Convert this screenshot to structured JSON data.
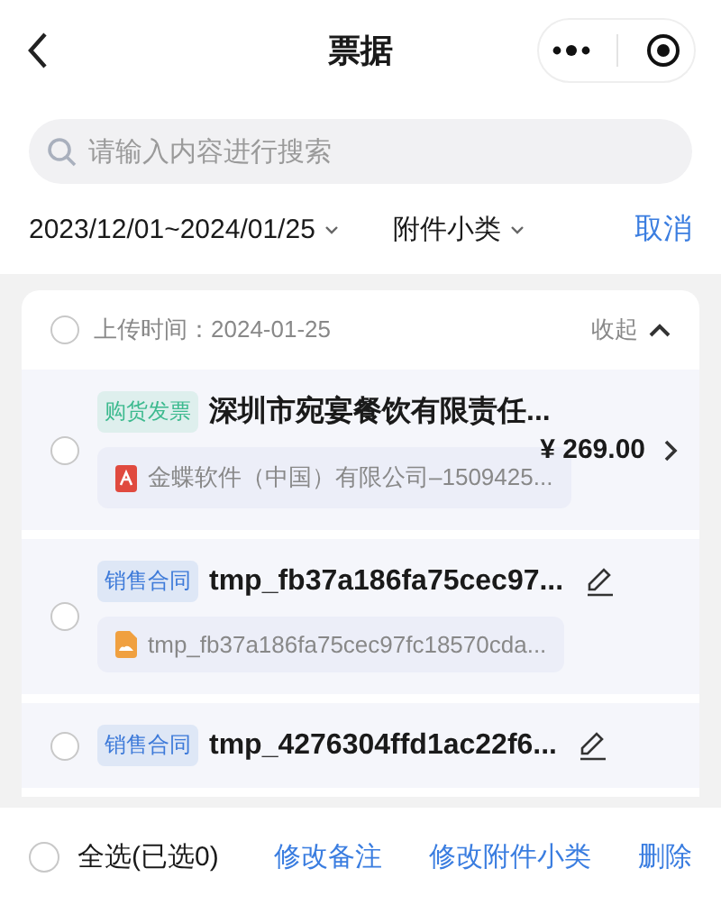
{
  "header": {
    "title": "票据"
  },
  "search": {
    "placeholder": "请输入内容进行搜索"
  },
  "filters": {
    "date_range": "2023/12/01~2024/01/25",
    "subtype": "附件小类",
    "cancel": "取消"
  },
  "group": {
    "checked": false,
    "upload_label": "上传时间：2024-01-25",
    "collapse": "收起",
    "expanded": true,
    "items": [
      {
        "tag": "购货发票",
        "color": "#3dba8f",
        "title": "深圳市宛宴餐饮有限责任...",
        "price": "¥ 269.00",
        "file": {
          "kind": "pdf",
          "name": "金蝶软件（中国）有限公司–1509425..."
        },
        "checked": false,
        "editable": false
      },
      {
        "tag": "销售合同",
        "color": "#3d7ad9",
        "title": "tmp_fb37a186fa75cec97...",
        "editable": true,
        "file": {
          "kind": "image",
          "name": "tmp_fb37a186fa75cec97fc18570cda..."
        },
        "checked": false
      },
      {
        "tag": "销售合同",
        "color": "#3d7ad9",
        "title": "tmp_4276304ffd1ac22f6...",
        "editable": true,
        "checked": false
      }
    ]
  },
  "bottom_bar": {
    "select_all": "全选(已选0)",
    "select_all_checked": false,
    "actions": [
      "修改备注",
      "修改附件小类",
      "删除"
    ]
  }
}
